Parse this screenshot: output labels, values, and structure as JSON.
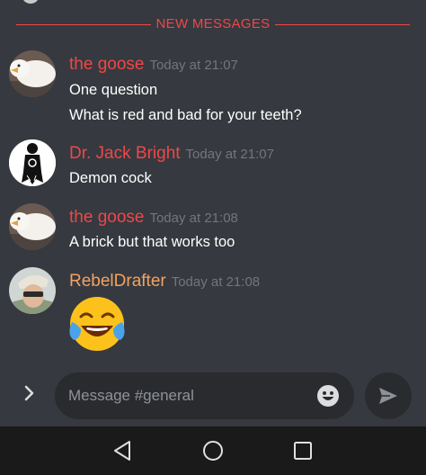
{
  "divider": {
    "label": "NEW MESSAGES"
  },
  "messages": [
    {
      "author": "the goose",
      "timestamp": "Today at 21:07",
      "lines": [
        "One question",
        "What is red and bad for your teeth?"
      ],
      "author_color": "#f04747",
      "avatar": "goose-avatar"
    },
    {
      "author": "Dr. Jack Bright",
      "timestamp": "Today at 21:07",
      "lines": [
        "Demon cock"
      ],
      "author_color": "#f04747",
      "avatar": "jack-bright-avatar"
    },
    {
      "author": "the goose",
      "timestamp": "Today at 21:08",
      "lines": [
        "A brick but that works too"
      ],
      "author_color": "#f04747",
      "avatar": "goose-avatar"
    },
    {
      "author": "RebelDrafter",
      "timestamp": "Today at 21:08",
      "lines": [],
      "emoji": "face-with-tears-of-joy",
      "author_color": "#f4a261",
      "avatar": "rebeldrafter-avatar"
    }
  ],
  "composer": {
    "placeholder": "Message #general",
    "expand_icon": "chevron-right-icon",
    "emoji_icon": "smiley-icon",
    "send_icon": "send-icon"
  },
  "navbar": {
    "back_icon": "triangle-back-icon",
    "home_icon": "circle-home-icon",
    "recents_icon": "square-recents-icon"
  },
  "colors": {
    "background": "#36393f",
    "new_messages": "#f04747",
    "timestamp": "#72767d",
    "input_bg": "#292b2f",
    "navbar_bg": "#1a1a1a"
  }
}
